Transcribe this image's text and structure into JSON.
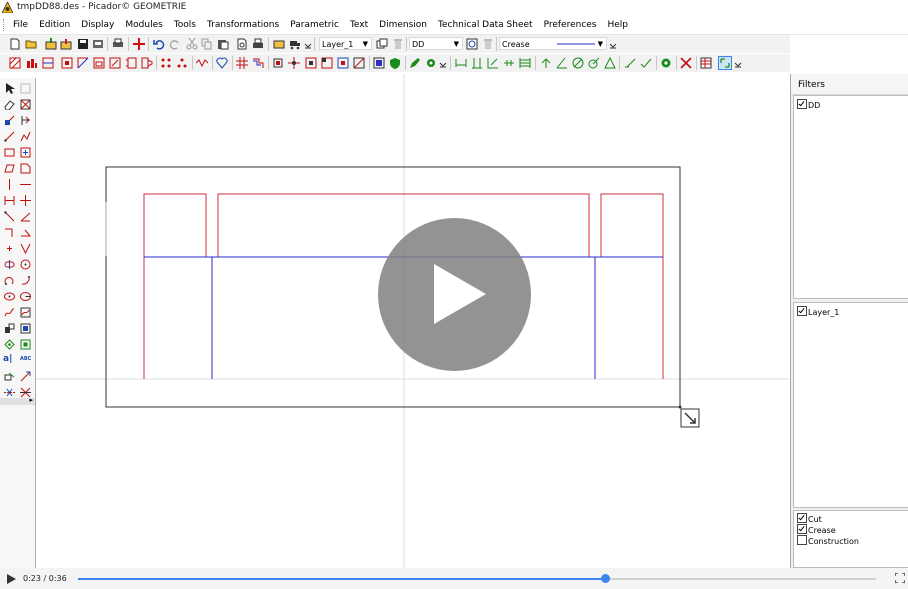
{
  "window": {
    "title": "tmpDD88.des - Picador© GEOMETRIE"
  },
  "menu": [
    "File",
    "Edition",
    "Display",
    "Modules",
    "Tools",
    "Transformations",
    "Parametric",
    "Text",
    "Dimension",
    "Technical Data Sheet",
    "Preferences",
    "Help"
  ],
  "toolbar": {
    "layer_select": "Layer_1",
    "filter_select": "DD",
    "linetype_select": "Crease"
  },
  "filters": {
    "title": "Filters",
    "group1": [
      {
        "label": "DD",
        "checked": true
      }
    ],
    "group2": [
      {
        "label": "Layer_1",
        "checked": true
      }
    ],
    "group3": [
      {
        "label": "Cut",
        "checked": true
      },
      {
        "label": "Crease",
        "checked": true
      },
      {
        "label": "Construction",
        "checked": false
      }
    ]
  },
  "video": {
    "time": "0:23 / 0:36",
    "progress": 0.661
  },
  "colors": {
    "cut": "#d32f3f",
    "crease": "#2b2bd0",
    "accent": "#3c84f0"
  }
}
